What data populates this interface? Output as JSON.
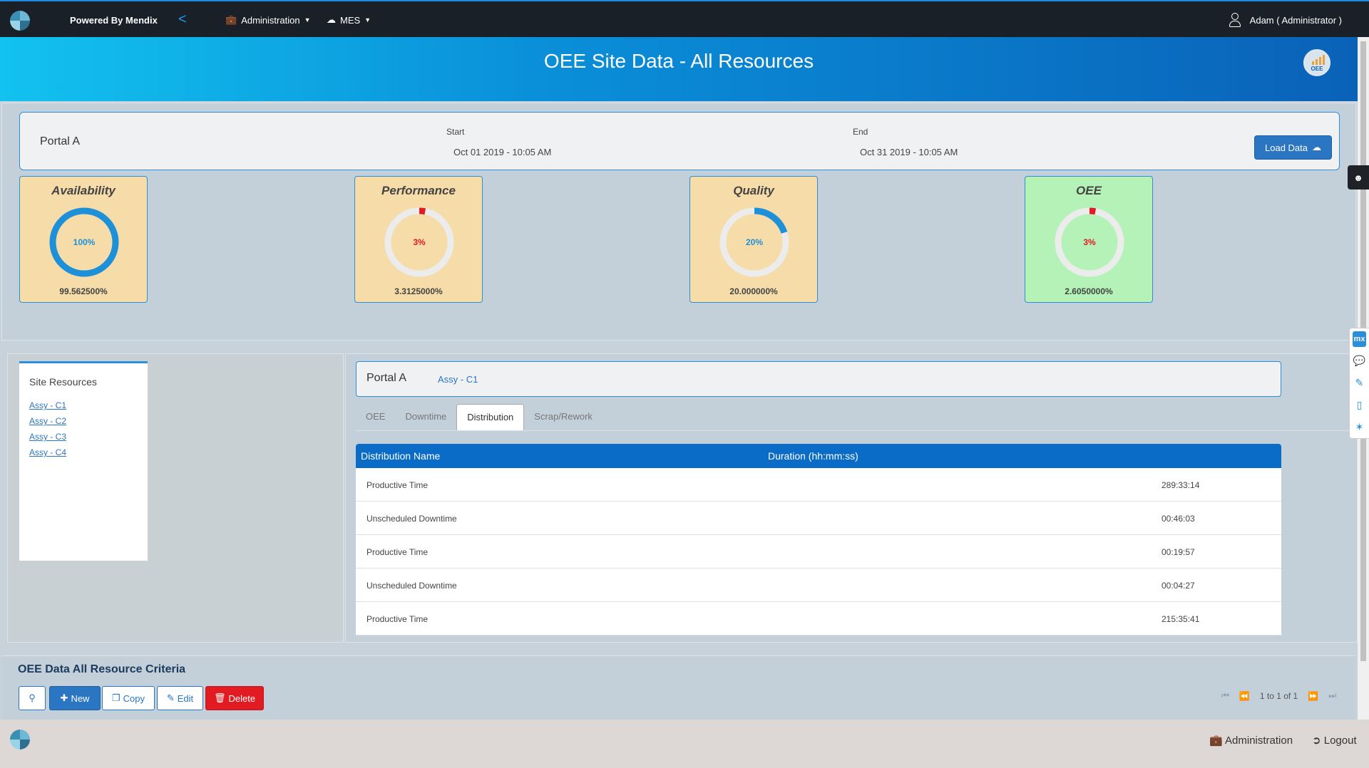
{
  "topbar": {
    "powered_by": "Powered By Mendix",
    "back_label": "<",
    "menus": [
      {
        "label": "Administration",
        "icon": "briefcase-icon"
      },
      {
        "label": "MES",
        "icon": "cloud-icon"
      }
    ],
    "user": "Adam ( Administrator )"
  },
  "banner": {
    "title": "OEE Site Data - All Resources",
    "badge_label": "OEE"
  },
  "portal": {
    "name": "Portal A",
    "start_label": "Start",
    "start_value": "Oct 01 2019 - 10:05 AM",
    "end_label": "End",
    "end_value": "Oct 31 2019 - 10:05 AM",
    "load_button": "Load Data"
  },
  "kpis": [
    {
      "title": "Availability",
      "gauge_label": "100%",
      "value": "99.562500%",
      "fraction": 1.0,
      "color": "#1e90d8"
    },
    {
      "title": "Performance",
      "gauge_label": "3%",
      "value": "3.3125000%",
      "fraction": 0.03,
      "color": "#e21b23"
    },
    {
      "title": "Quality",
      "gauge_label": "20%",
      "value": "20.000000%",
      "fraction": 0.2,
      "color": "#1e90d8"
    },
    {
      "title": "OEE",
      "gauge_label": "3%",
      "value": "2.6050000%",
      "fraction": 0.03,
      "color": "#e21b23"
    }
  ],
  "resources": {
    "title": "Site Resources",
    "items": [
      "Assy - C1",
      "Assy - C2",
      "Assy - C3",
      "Assy - C4"
    ]
  },
  "detail": {
    "portal_name": "Portal A",
    "resource": "Assy - C1",
    "tabs": [
      "OEE",
      "Downtime",
      "Distribution",
      "Scrap/Rework"
    ],
    "active_tab": "Distribution",
    "columns": [
      "Distribution Name",
      "Duration (hh:mm:ss)"
    ],
    "rows": [
      [
        "Productive Time",
        "289:33:14"
      ],
      [
        "Unscheduled Downtime",
        "00:46:03"
      ],
      [
        "Productive Time",
        "00:19:57"
      ],
      [
        "Unscheduled Downtime",
        "00:04:27"
      ],
      [
        "Productive Time",
        "215:35:41"
      ]
    ]
  },
  "criteria": {
    "title": "OEE Data All Resource Criteria",
    "buttons": {
      "new": "New",
      "copy": "Copy",
      "edit": "Edit",
      "delete": "Delete"
    },
    "pager": "1 to 1 of 1"
  },
  "footer": {
    "administration": "Administration",
    "logout": "Logout"
  },
  "side_tools": {
    "mx": "mx"
  }
}
